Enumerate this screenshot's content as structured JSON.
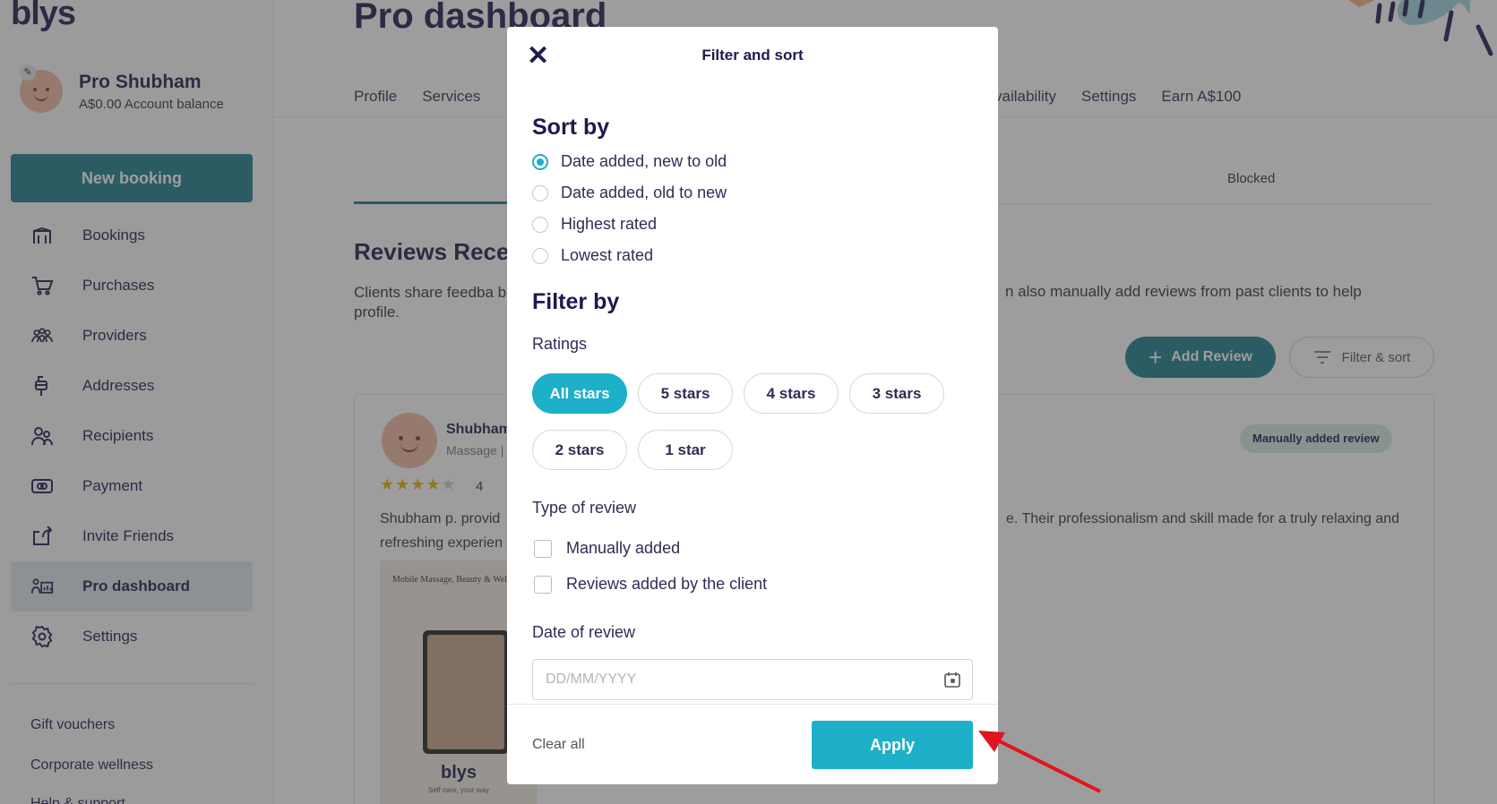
{
  "app": {
    "logo": "blys"
  },
  "profile": {
    "name": "Pro Shubham",
    "balance": "A$0.00 Account balance"
  },
  "sidebar": {
    "new_booking": "New booking",
    "items": [
      {
        "label": "Bookings",
        "icon": "bookings-icon"
      },
      {
        "label": "Purchases",
        "icon": "cart-icon"
      },
      {
        "label": "Providers",
        "icon": "providers-icon"
      },
      {
        "label": "Addresses",
        "icon": "mailbox-icon"
      },
      {
        "label": "Recipients",
        "icon": "recipients-icon"
      },
      {
        "label": "Payment",
        "icon": "payment-icon"
      },
      {
        "label": "Invite Friends",
        "icon": "share-icon"
      },
      {
        "label": "Pro dashboard",
        "icon": "pro-dashboard-icon",
        "active": true
      },
      {
        "label": "Settings",
        "icon": "gear-icon"
      }
    ],
    "gift_vouchers": "Gift vouchers",
    "corporate_wellness": "Corporate wellness",
    "help_support": "Help & support"
  },
  "main": {
    "title": "Pro dashboard",
    "tabs_left": [
      "Profile",
      "Services"
    ],
    "tabs_right": [
      "vailability",
      "Settings",
      "Earn A$100"
    ],
    "blocked_tab": "Blocked",
    "section_title": "Reviews Rece",
    "section_desc": "Clients share feedba build your profile.",
    "section_desc_right": "n also manually add reviews from past clients to help",
    "add_review": "Add Review",
    "filter_sort": "Filter & sort",
    "review": {
      "name": "Shubham",
      "sub": "Massage |",
      "rating": "4",
      "text_1": "Shubham p. provid",
      "text_2": "refreshing experien",
      "text_right": "e. Their professionalism and skill made for a truly relaxing and",
      "badge": "Manually added review",
      "thumb_title": "Mobile Massage, Beauty & Wellness",
      "thumb_logo": "blys",
      "thumb_tag": "Self care, your way"
    }
  },
  "modal": {
    "title": "Filter and sort",
    "sort_heading": "Sort by",
    "sort_options": [
      {
        "label": "Date added, new to old",
        "selected": true
      },
      {
        "label": "Date added, old to new",
        "selected": false
      },
      {
        "label": "Highest rated",
        "selected": false
      },
      {
        "label": "Lowest rated",
        "selected": false
      }
    ],
    "filter_heading": "Filter by",
    "ratings_label": "Ratings",
    "rating_chips": [
      {
        "label": "All stars",
        "selected": true
      },
      {
        "label": "5 stars",
        "selected": false
      },
      {
        "label": "4 stars",
        "selected": false
      },
      {
        "label": "3 stars",
        "selected": false
      },
      {
        "label": "2 stars",
        "selected": false
      },
      {
        "label": "1 star",
        "selected": false
      }
    ],
    "type_label": "Type of review",
    "type_options": [
      "Manually added",
      "Reviews added by the client"
    ],
    "date_label": "Date of review",
    "date_placeholder": "DD/MM/YYYY",
    "clear_all": "Clear all",
    "apply": "Apply"
  },
  "colors": {
    "accent": "#1db0c8",
    "brand_dark": "#1d1a4f",
    "primary_teal": "#1b7d8c",
    "annotation_arrow": "#e0151f"
  }
}
